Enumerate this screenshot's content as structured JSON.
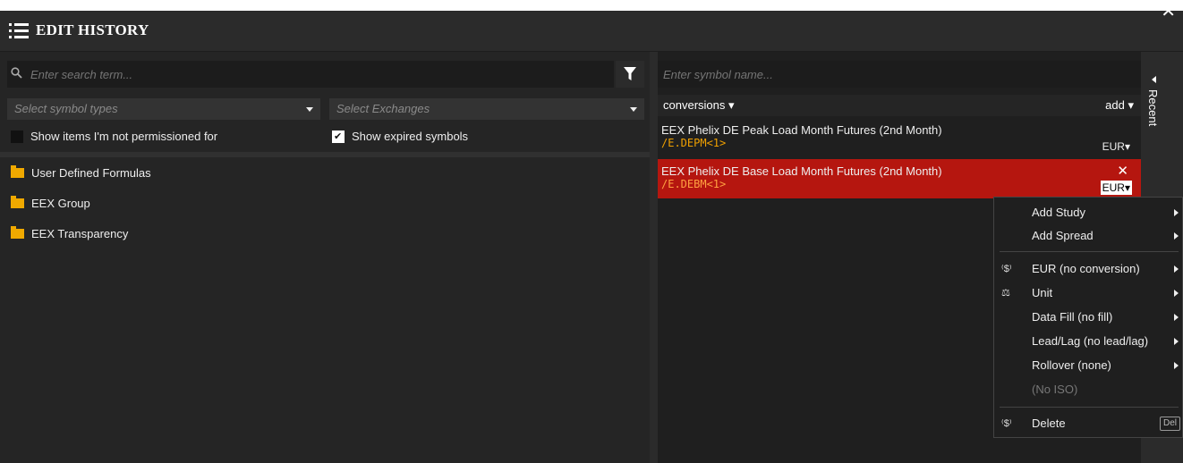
{
  "title": "EDIT HISTORY",
  "left": {
    "search_placeholder": "Enter search term...",
    "symbol_types_placeholder": "Select symbol types",
    "exchanges_placeholder": "Select Exchanges",
    "show_not_permissioned_label": "Show items I'm not permissioned for",
    "show_not_permissioned_checked": false,
    "show_expired_label": "Show expired symbols",
    "show_expired_checked": true,
    "tree": [
      {
        "label": "User Defined Formulas"
      },
      {
        "label": "EEX Group"
      },
      {
        "label": "EEX Transparency"
      }
    ]
  },
  "right": {
    "symbol_placeholder": "Enter symbol name...",
    "conversions_label": "conversions",
    "add_label": "add",
    "items": [
      {
        "name": "EEX Phelix DE Peak Load Month Futures (2nd Month)",
        "symbol": "/E.DEPM<1>",
        "currency": "EUR",
        "selected": false
      },
      {
        "name": "EEX Phelix DE Base Load Month Futures (2nd Month)",
        "symbol": "/E.DEBM<1>",
        "currency": "EUR",
        "selected": true
      }
    ],
    "recent_tab": "Recent"
  },
  "menu": {
    "items": [
      {
        "label": "Add Study",
        "icon": "",
        "submenu": true
      },
      {
        "label": "Add Spread",
        "icon": "",
        "submenu": true
      },
      {
        "label": "EUR (no conversion)",
        "icon": "currency-convert-icon",
        "submenu": true
      },
      {
        "label": "Unit",
        "icon": "weight-icon",
        "submenu": true
      },
      {
        "label": "Data Fill (no fill)",
        "icon": "",
        "submenu": true
      },
      {
        "label": "Lead/Lag (no lead/lag)",
        "icon": "",
        "submenu": true
      },
      {
        "label": "Rollover (none)",
        "icon": "",
        "submenu": true
      },
      {
        "label": "(No ISO)",
        "icon": "",
        "submenu": false,
        "disabled": true
      },
      {
        "label": "Delete",
        "icon": "currency-convert-icon",
        "submenu": false,
        "shortcut": "Del"
      }
    ]
  },
  "colors": {
    "selected_row": "#b5160f",
    "symbol_text": "#f0a000",
    "folder": "#f0a900"
  }
}
